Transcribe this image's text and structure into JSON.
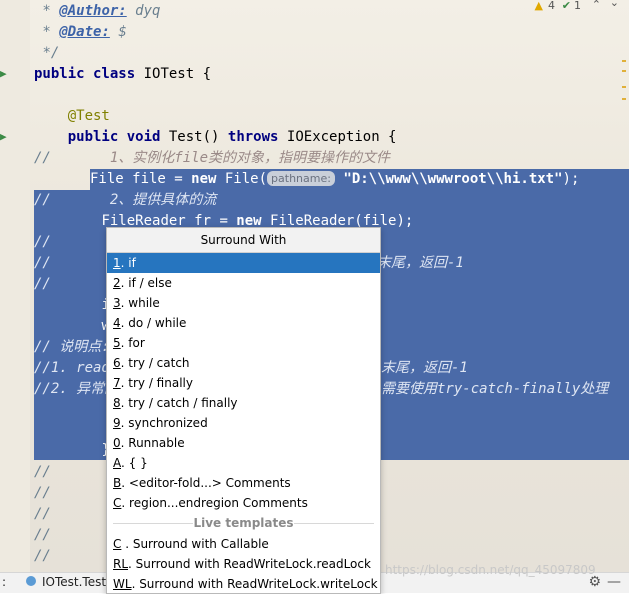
{
  "top_indicators": {
    "warnings": "4",
    "checks": "1"
  },
  "code": {
    "author_tag": "@Author:",
    "author_value": "dyq",
    "date_tag": "@Date:",
    "date_value": "$",
    "comment_end": "*/",
    "class_decl_kw": "public class",
    "class_decl_name": "IOTest {",
    "annotation": "@Test",
    "method_kw1": "public void",
    "method_name": "Test()",
    "method_throws": "throws",
    "method_exc": "IOException {",
    "comment_1_prefix": "//",
    "comment_1_text": "1、实例化file类的对象，指明要操作的文件",
    "sel_line_1a": "File file = ",
    "sel_line_1_new": "new",
    "sel_line_1b": " File(",
    "param_hint": "pathname:",
    "path_string": "\"D:\\\\www\\\\wwwroot\\\\hi.txt\"",
    "sel_line_1c": ");",
    "sel_comment_2_prefix": "//",
    "sel_comment_2_text": "2、提供具体的流",
    "sel_line_3a": "FileReader fr = ",
    "sel_line_3_new": "new",
    "sel_line_3b": " FileReader(file);",
    "sel_comment_prefix": "//",
    "sel_partial_1": "末尾，返回-1",
    "sel_partial_i": "i",
    "sel_partial_w": "w",
    "sel_note_prefix": "// 说明点:",
    "sel_note1_prefix": "//1. read",
    "sel_note1_tail": "末尾，返回-1",
    "sel_note2_prefix": "//2. 异常的",
    "sel_note2_tail": "需要使用try-catch-finally处理",
    "sel_closing": "}",
    "trailing_comment": "//"
  },
  "popup": {
    "title": "Surround With",
    "items": [
      {
        "key": "1",
        "label": ". if"
      },
      {
        "key": "2",
        "label": ". if / else"
      },
      {
        "key": "3",
        "label": ". while"
      },
      {
        "key": "4",
        "label": ". do / while"
      },
      {
        "key": "5",
        "label": ". for"
      },
      {
        "key": "6",
        "label": ". try / catch"
      },
      {
        "key": "7",
        "label": ". try / finally"
      },
      {
        "key": "8",
        "label": ". try / catch / finally"
      },
      {
        "key": "9",
        "label": ". synchronized"
      },
      {
        "key": "0",
        "label": ". Runnable"
      },
      {
        "key": "A",
        "label": ". { }"
      },
      {
        "key": "B",
        "label": ". <editor-fold...> Comments"
      },
      {
        "key": "C",
        "label": ". region...endregion Comments"
      }
    ],
    "live_templates_label": "Live templates",
    "templates": [
      {
        "key": "C",
        "label": " . Surround with Callable"
      },
      {
        "key": "RL",
        "label": ". Surround with ReadWriteLock.readLock"
      },
      {
        "key": "WL",
        "label": ". Surround with ReadWriteLock.writeLock"
      }
    ]
  },
  "statusbar": {
    "left_glyph": ":",
    "file_tab": "IOTest.Test"
  },
  "watermark": "https://blog.csdn.net/qq_45097809"
}
